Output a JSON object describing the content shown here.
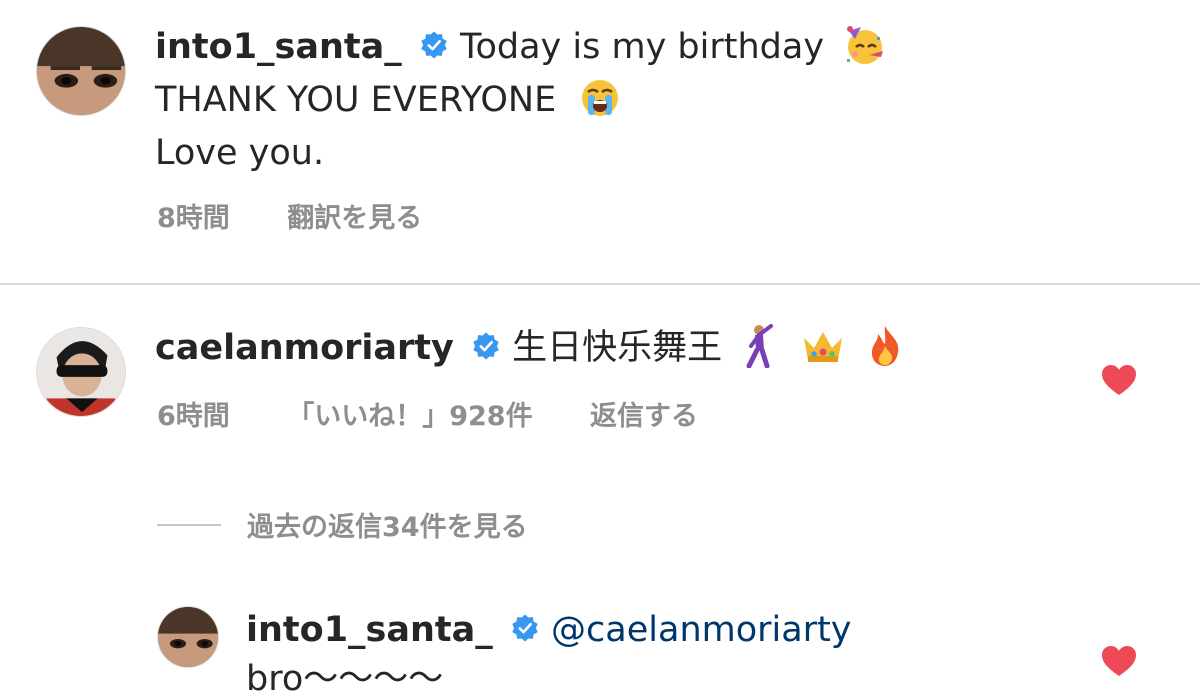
{
  "comments": [
    {
      "username": "into1_santa_",
      "verified": true,
      "text_lines": [
        "Today is my birthday",
        "THANK YOU EVERYONE",
        "Love you."
      ],
      "emojis": [
        "partying-face",
        "loudly-crying-face"
      ],
      "time": "8時間",
      "translate_label": "翻訳を見る"
    },
    {
      "username": "caelanmoriarty",
      "verified": true,
      "text": "生日快乐舞王",
      "emojis": [
        "dancing-man",
        "crown",
        "fire"
      ],
      "time": "6時間",
      "likes_label": "「いいね！」928件",
      "reply_label": "返信する",
      "liked": true,
      "view_replies_label": "過去の返信34件を見る"
    }
  ],
  "reply": {
    "username": "into1_santa_",
    "verified": true,
    "mention": "@caelanmoriarty",
    "text": "bro〜〜〜〜",
    "liked": true
  },
  "colors": {
    "text": "#262626",
    "secondary": "#8e8e8e",
    "verified": "#3897f0",
    "heart": "#ed4956",
    "mention": "#00376b",
    "divider": "#dbdbdb"
  }
}
